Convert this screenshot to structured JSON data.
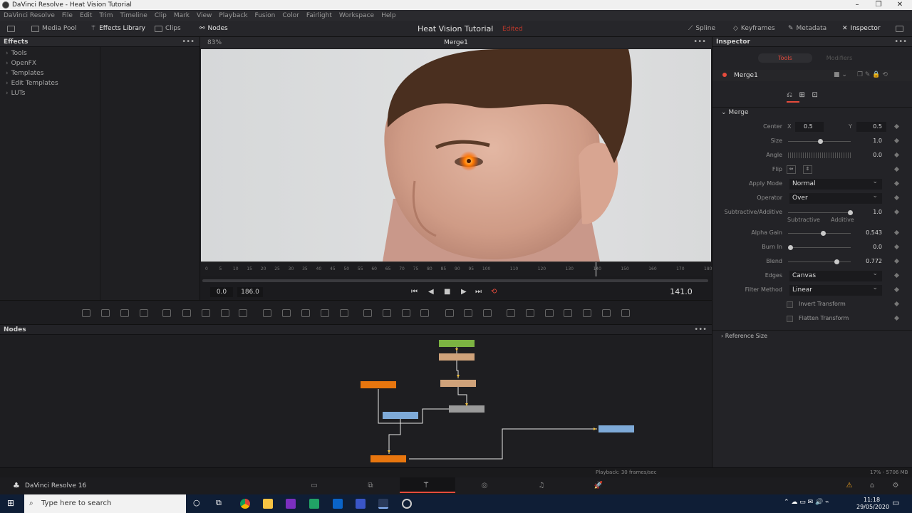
{
  "window": {
    "title": "DaVinci Resolve - Heat Vision Tutorial"
  },
  "menu": [
    "DaVinci Resolve",
    "File",
    "Edit",
    "Trim",
    "Timeline",
    "Clip",
    "Mark",
    "View",
    "Playback",
    "Fusion",
    "Color",
    "Fairlight",
    "Workspace",
    "Help"
  ],
  "toolbar": {
    "media_pool": "Media Pool",
    "effects_library": "Effects Library",
    "clips": "Clips",
    "nodes": "Nodes",
    "project_title": "Heat Vision Tutorial",
    "edited": "Edited",
    "spline": "Spline",
    "keyframes": "Keyframes",
    "metadata": "Metadata",
    "inspector": "Inspector"
  },
  "effects": {
    "header": "Effects",
    "items": [
      "Tools",
      "OpenFX",
      "Templates",
      "Edit Templates",
      "LUTs"
    ]
  },
  "viewer": {
    "zoom": "83%",
    "name": "Merge1",
    "ruler": [
      "0",
      "5",
      "10",
      "15",
      "20",
      "25",
      "30",
      "35",
      "40",
      "45",
      "50",
      "55",
      "60",
      "65",
      "70",
      "75",
      "80",
      "85",
      "90",
      "95",
      "100",
      "110",
      "120",
      "130",
      "140",
      "150",
      "160",
      "170",
      "180"
    ],
    "start": "0.0",
    "end": "186.0",
    "current": "141.0"
  },
  "nodes": {
    "header": "Nodes"
  },
  "inspector": {
    "header": "Inspector",
    "tab_tools": "Tools",
    "tab_modifiers": "Modifiers",
    "node_name": "Merge1",
    "section": "Merge",
    "center_label": "Center",
    "x_label": "X",
    "center_x": "0.5",
    "y_label": "Y",
    "center_y": "0.5",
    "size_label": "Size",
    "size": "1.0",
    "size_level": 0.5,
    "angle_label": "Angle",
    "angle": "0.0",
    "flip_label": "Flip",
    "apply_mode_label": "Apply Mode",
    "apply_mode": "Normal",
    "operator_label": "Operator",
    "operator": "Over",
    "subadd_label": "Subtractive/Additive",
    "subadd": "1.0",
    "subadd_level": 1.0,
    "subtractive": "Subtractive",
    "additive": "Additive",
    "alpha_gain_label": "Alpha Gain",
    "alpha_gain": "0.543",
    "alpha_gain_level": 0.543,
    "burn_in_label": "Burn In",
    "burn_in": "0.0",
    "burn_in_level": 0.0,
    "blend_label": "Blend",
    "blend": "0.772",
    "blend_level": 0.772,
    "edges_label": "Edges",
    "edges": "Canvas",
    "filter_label": "Filter Method",
    "filter": "Linear",
    "invert_transform": "Invert Transform",
    "flatten_transform": "Flatten Transform",
    "reference_size": "Reference Size"
  },
  "status": {
    "playback": "Playback: 30 frames/sec",
    "memory": "17% - 5706 MB"
  },
  "pagebar": {
    "app_name": "DaVinci Resolve 16"
  },
  "taskbar": {
    "search_placeholder": "Type here to search",
    "time": "11:18",
    "date": "29/05/2020"
  },
  "colors": {
    "accent_red": "#e64b3c",
    "node_orange": "#e8760e",
    "node_green": "#7cb342",
    "node_tan": "#cfa27a",
    "node_blue": "#7eaad8",
    "node_grey": "#9a9a9a"
  }
}
